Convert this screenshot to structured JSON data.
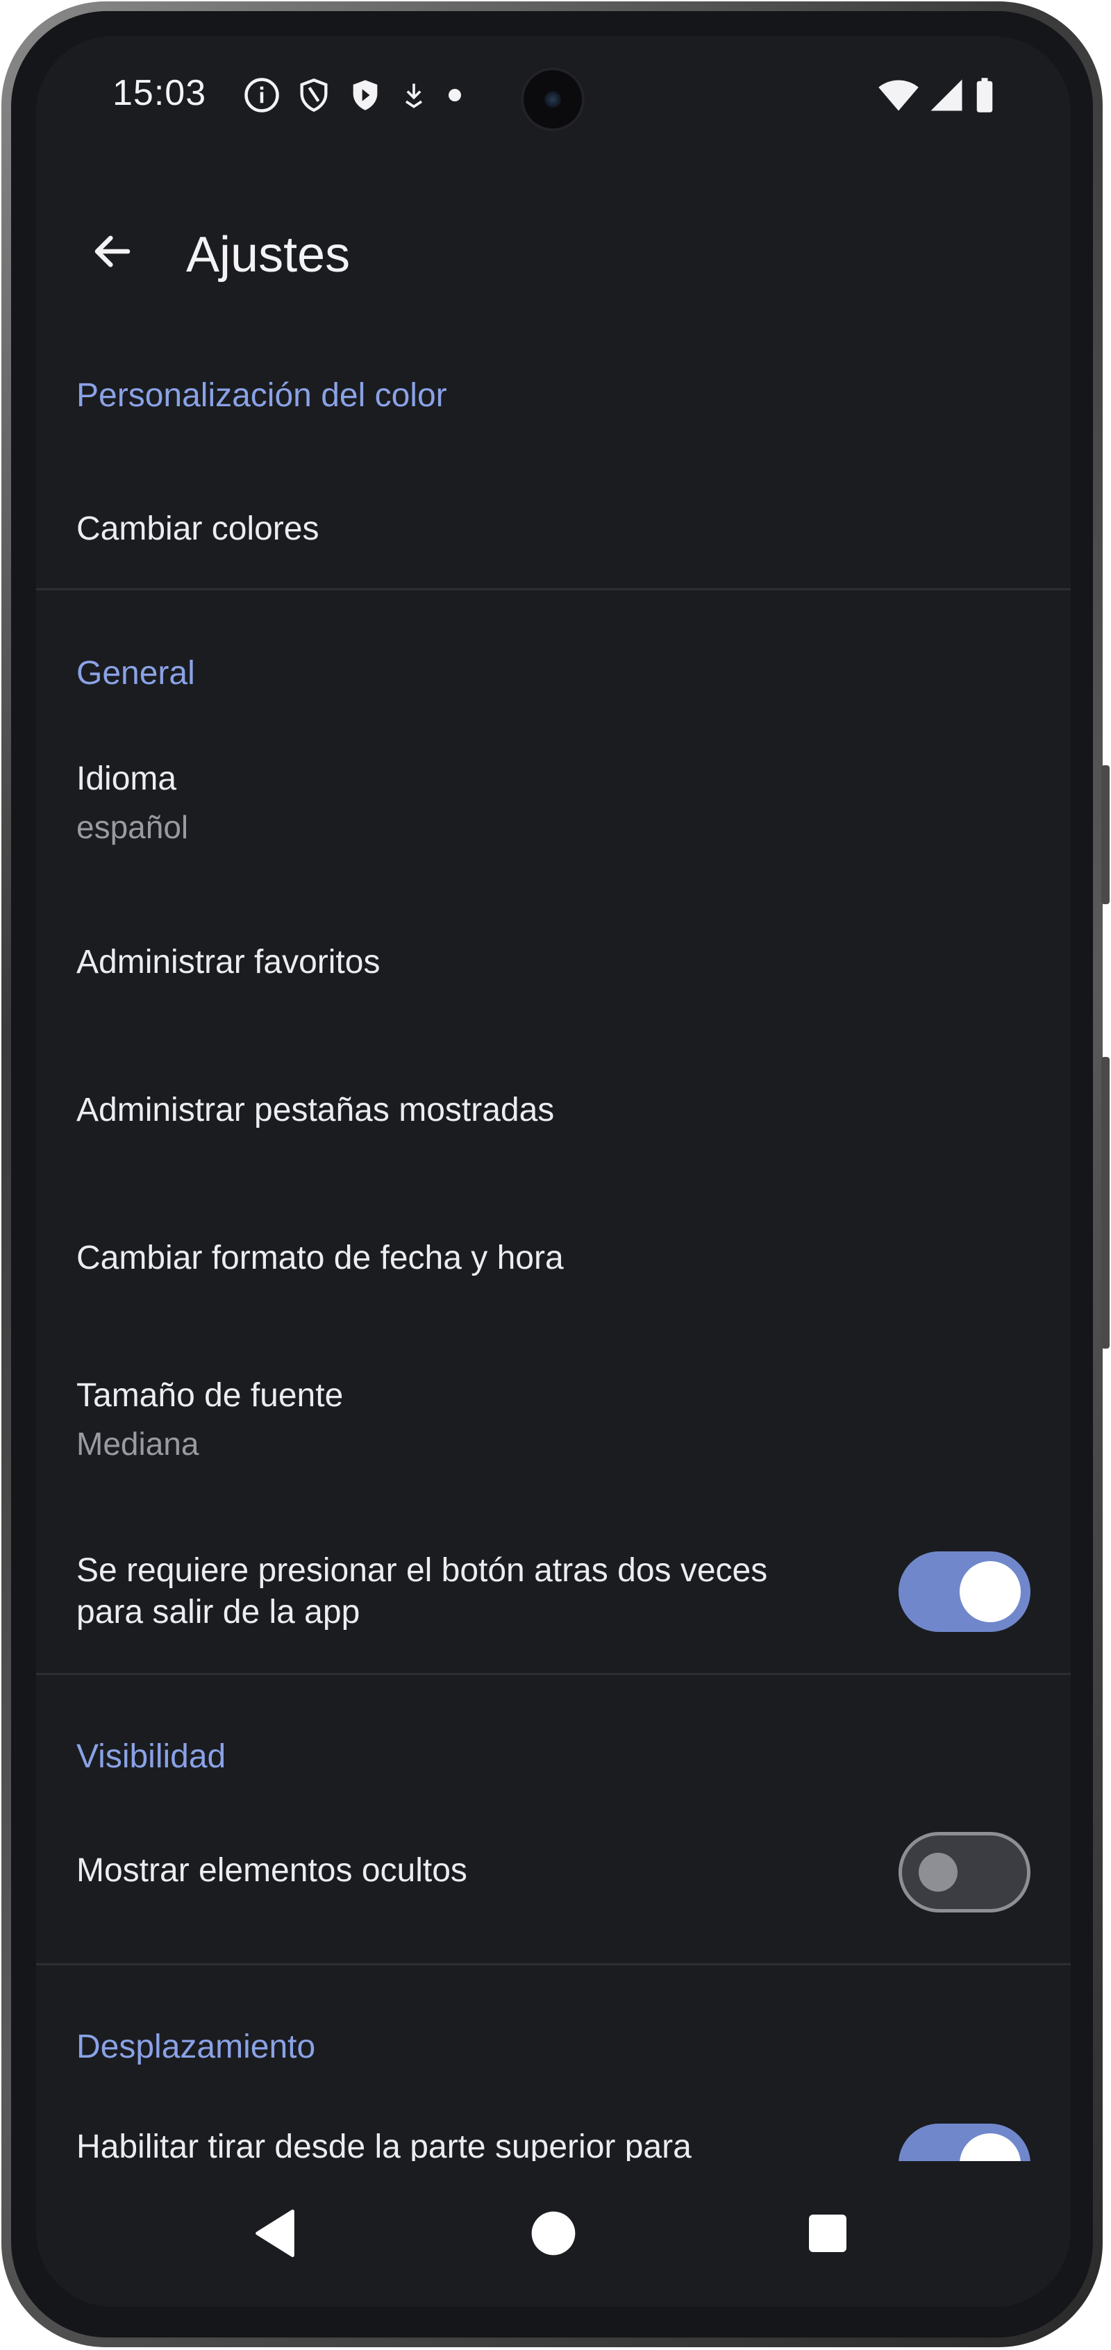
{
  "status_bar": {
    "time": "15:03",
    "left_icons": [
      "info-icon",
      "shield-icon",
      "play-shield-icon",
      "download-icon",
      "dot-icon"
    ],
    "right_icons": [
      "wifi-icon",
      "signal-icon",
      "battery-icon"
    ]
  },
  "toolbar": {
    "title": "Ajustes",
    "back_icon": "arrow-back-icon"
  },
  "sections": {
    "color": {
      "header": "Personalización del color",
      "items": {
        "change_colors": {
          "title": "Cambiar colores"
        }
      }
    },
    "general": {
      "header": "General",
      "items": {
        "language": {
          "title": "Idioma",
          "summary": "español"
        },
        "favorites": {
          "title": "Administrar favoritos"
        },
        "tabs": {
          "title": "Administrar pestañas mostradas"
        },
        "date_format": {
          "title": "Cambiar formato de fecha y hora"
        },
        "font_size": {
          "title": "Tamaño de fuente",
          "summary": "Mediana"
        },
        "press_back_twice": {
          "title_line1": "Se requiere presionar el botón atras dos veces",
          "title_line2": "para salir de la app",
          "checked": true
        }
      }
    },
    "visibility": {
      "header": "Visibilidad",
      "items": {
        "show_hidden": {
          "title": "Mostrar elementos ocultos",
          "checked": false
        }
      }
    },
    "scrolling": {
      "header": "Desplazamiento",
      "items": {
        "pull_to_refresh": {
          "title": "Habilitar tirar desde la parte superior para",
          "checked": true
        }
      }
    }
  },
  "nav_bar": {
    "buttons": [
      "back-triangle-icon",
      "home-circle-icon",
      "recents-square-icon"
    ]
  },
  "colors": {
    "background": "#1b1c20",
    "accent": "#7088cb",
    "section_header": "#8aa2e6",
    "primary_text": "#ecedf1",
    "secondary_text": "#9a9ba2"
  }
}
